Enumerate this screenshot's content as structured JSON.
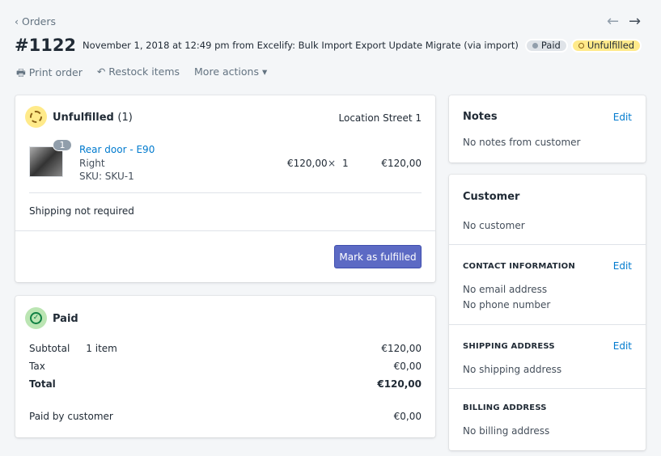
{
  "breadcrumb": {
    "label": "Orders"
  },
  "order": {
    "number": "#1122",
    "meta": "November 1, 2018 at 12:49 pm from Excelify: Bulk Import Export Update Migrate (via import)",
    "badge_paid": "Paid",
    "badge_fulfillment": "Unfulfilled"
  },
  "actions": {
    "print": "Print order",
    "restock": "Restock items",
    "more": "More actions"
  },
  "unfulfilled": {
    "title": "Unfulfilled",
    "count": "(1)",
    "location": "Location Street 1",
    "item": {
      "name": "Rear door - E90",
      "variant": "Right",
      "sku": "SKU: SKU-1",
      "qty_badge": "1",
      "price": "€120,00",
      "times": "×",
      "qty": "1",
      "total": "€120,00"
    },
    "shipping": "Shipping not required",
    "button": "Mark as fulfilled"
  },
  "paid": {
    "title": "Paid",
    "subtotal_label": "Subtotal",
    "subtotal_items": "1 item",
    "subtotal": "€120,00",
    "tax_label": "Tax",
    "tax": "€0,00",
    "total_label": "Total",
    "total": "€120,00",
    "paid_by_label": "Paid by customer",
    "paid_by": "€0,00"
  },
  "notes": {
    "title": "Notes",
    "edit": "Edit",
    "text": "No notes from customer"
  },
  "customer": {
    "title": "Customer",
    "text": "No customer",
    "contact": {
      "title": "CONTACT INFORMATION",
      "edit": "Edit",
      "email": "No email address",
      "phone": "No phone number"
    },
    "shipping": {
      "title": "SHIPPING ADDRESS",
      "edit": "Edit",
      "text": "No shipping address"
    },
    "billing": {
      "title": "BILLING ADDRESS",
      "text": "No billing address"
    }
  },
  "colors": {
    "accent": "#5c6ac4",
    "link": "#007ace",
    "warning": "#ffea8a",
    "success": "#bbe5b3"
  }
}
